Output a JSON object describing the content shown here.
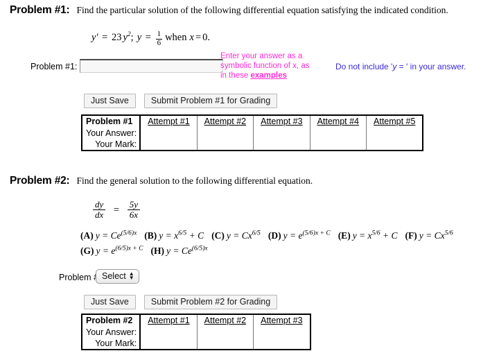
{
  "problem1": {
    "heading": "Problem #1:",
    "statement": "Find the particular solution of the following differential equation satisfying the indicated condition.",
    "equation": {
      "lhs": "y'",
      "eq": "=",
      "coefficient": "23",
      "variable": "y",
      "exponent": "2",
      "semicolon": ";",
      "initial_var": "y",
      "initial_eq": "=",
      "initial_numerator": "1",
      "initial_denominator": "6",
      "when_text": "when",
      "when_var": "x",
      "when_eq": "=",
      "when_value": "0",
      "period": "."
    },
    "answer_label": "Problem #1:",
    "answer_value": "",
    "answer_placeholder": "",
    "hint_pink_line1": "Enter your answer as a",
    "hint_pink_line2": "symbolic function of x, as",
    "hint_pink_line3_pre": "in these ",
    "hint_pink_link": "examples",
    "hint_blue_pre": "Do not include '",
    "hint_blue_italic": "y",
    "hint_blue_mid": " = ",
    "hint_blue_post": "' in your answer.",
    "save_label": "Just Save",
    "submit_label": "Submit Problem #1 for Grading",
    "table": {
      "corner_label": "Problem #1",
      "row_labels": [
        "Your Answer:",
        "Your Mark:"
      ],
      "columns": [
        "Attempt #1",
        "Attempt #2",
        "Attempt #3",
        "Attempt #4",
        "Attempt #5"
      ],
      "answers": [
        "",
        "",
        "",
        "",
        ""
      ],
      "marks": [
        "",
        "",
        "",
        "",
        ""
      ]
    }
  },
  "problem2": {
    "heading": "Problem #2:",
    "statement": "Find the general solution to the following differential equation.",
    "equation": {
      "lhs_num": "dy",
      "lhs_den": "dx",
      "eq": "=",
      "rhs_num": "5y",
      "rhs_den": "6x"
    },
    "choices": [
      {
        "label": "(A)",
        "expr": "y = Ce^((5/6)x)",
        "base": "y = Ce",
        "exp": "(5/6)x"
      },
      {
        "label": "(B)",
        "expr": "y = x^(6/5) + C",
        "base": "y = x",
        "exp": "6/5",
        "tail": " + C"
      },
      {
        "label": "(C)",
        "expr": "y = Cx^(6/5)",
        "base": "y = Cx",
        "exp": "6/5"
      },
      {
        "label": "(D)",
        "expr": "y = e^((5/6)x + C)",
        "base": "y = e",
        "exp": "(5/6)x + C"
      },
      {
        "label": "(E)",
        "expr": "y = x^(5/6) + C",
        "base": "y = x",
        "exp": "5/6",
        "tail": " + C"
      },
      {
        "label": "(F)",
        "expr": "y = Cx^(5/6)",
        "base": "y = Cx",
        "exp": "5/6"
      },
      {
        "label": "(G)",
        "expr": "y = e^((6/5)x + C)",
        "base": "y = e",
        "exp": "(6/5)x + C"
      },
      {
        "label": "(H)",
        "expr": "y = Ce^((6/5)x)",
        "base": "y = Ce",
        "exp": "(6/5)x"
      }
    ],
    "answer_label": "Problem #2:",
    "select_value": "Select",
    "save_label": "Just Save",
    "submit_label": "Submit Problem #2 for Grading",
    "table": {
      "corner_label": "Problem #2",
      "row_labels": [
        "Your Answer:",
        "Your Mark:"
      ],
      "columns": [
        "Attempt #1",
        "Attempt #2",
        "Attempt #3"
      ],
      "answers": [
        "",
        "",
        ""
      ],
      "marks": [
        "",
        "",
        ""
      ]
    }
  },
  "colors": {
    "hint_pink": "#ff2ad4",
    "hint_blue": "#3a28d6",
    "text": "#000000",
    "button_bg": "#f4f4f4",
    "input_bg": "#f7f7f7"
  }
}
